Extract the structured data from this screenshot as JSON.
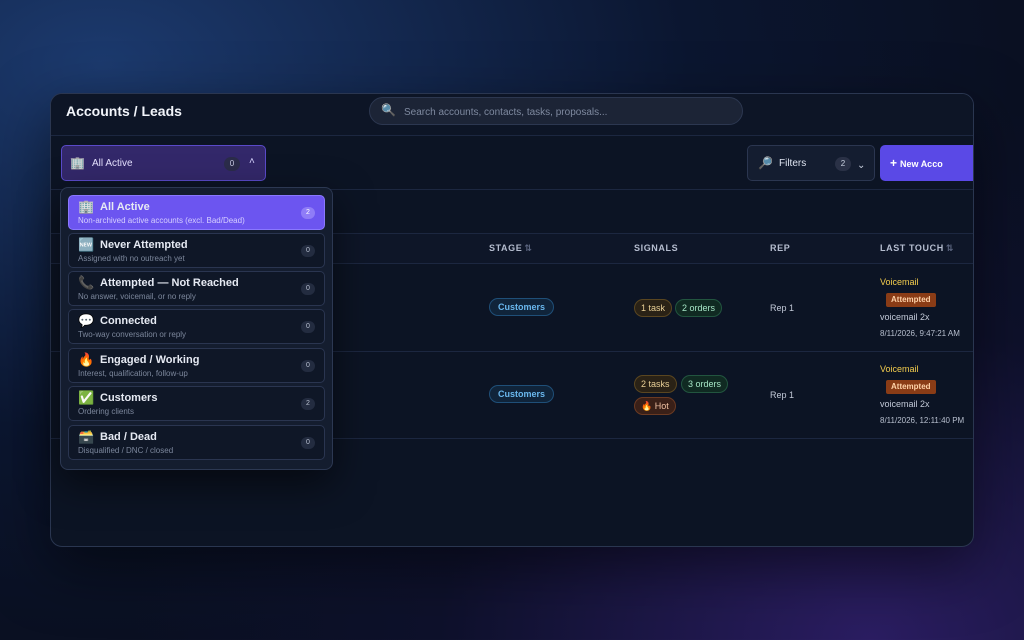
{
  "header": {
    "title": "Accounts / Leads",
    "search_placeholder": "Search accounts, contacts, tasks, proposals..."
  },
  "toolbar": {
    "segment": {
      "label": "All Active",
      "count": "0"
    },
    "filters": {
      "label": "Filters",
      "count": "2"
    },
    "new_label": "New Acco"
  },
  "table": {
    "columns": [
      {
        "label": "STAGE",
        "sortable": true
      },
      {
        "label": "SIGNALS",
        "sortable": false
      },
      {
        "label": "REP",
        "sortable": false
      },
      {
        "label": "LAST TOUCH",
        "sortable": true
      }
    ],
    "rows": [
      {
        "stage": "Customers",
        "signals": [
          "1 task",
          "2 orders"
        ],
        "rep": "Rep 1",
        "last_touch": {
          "type": "Voicemail",
          "status": "Attempted",
          "note": "voicemail 2x",
          "time": "8/11/2026, 9:47:21 AM"
        }
      },
      {
        "stage": "Customers",
        "signals": [
          "2 tasks",
          "3 orders",
          "🔥 Hot"
        ],
        "rep": "Rep 1",
        "last_touch": {
          "type": "Voicemail",
          "status": "Attempted",
          "note": "voicemail 2x",
          "time": "8/11/2026, 12:11:40 PM"
        }
      }
    ]
  },
  "dropdown": {
    "options": [
      {
        "icon": "🏢",
        "name": "All Active",
        "desc": "Non-archived active accounts (excl. Bad/Dead)",
        "count": "2",
        "active": true
      },
      {
        "icon": "🆕",
        "name": "Never Attempted",
        "desc": "Assigned with no outreach yet",
        "count": "0",
        "active": false
      },
      {
        "icon": "📞",
        "name": "Attempted — Not Reached",
        "desc": "No answer, voicemail, or no reply",
        "count": "0",
        "active": false
      },
      {
        "icon": "💬",
        "name": "Connected",
        "desc": "Two-way conversation or reply",
        "count": "0",
        "active": false
      },
      {
        "icon": "🔥",
        "name": "Engaged / Working",
        "desc": "Interest, qualification, follow-up",
        "count": "0",
        "active": false
      },
      {
        "icon": "✅",
        "name": "Customers",
        "desc": "Ordering clients",
        "count": "2",
        "active": false
      },
      {
        "icon": "🗃️",
        "name": "Bad / Dead",
        "desc": "Disqualified / DNC / closed",
        "count": "0",
        "active": false
      }
    ]
  },
  "icons": {
    "search": "search-icon",
    "segment": "building-icon",
    "filters": "filter-icon",
    "new": "plus-icon",
    "chevron_up": "chevron-up-icon",
    "chevron_down": "chevron-down-icon"
  },
  "colors": {
    "accent": "#5a49e6",
    "active_option": "#6c55f0",
    "stage": "#6ab8ee",
    "voicemail": "#f4cd4d",
    "attempted_badge": "#8a3c16"
  }
}
